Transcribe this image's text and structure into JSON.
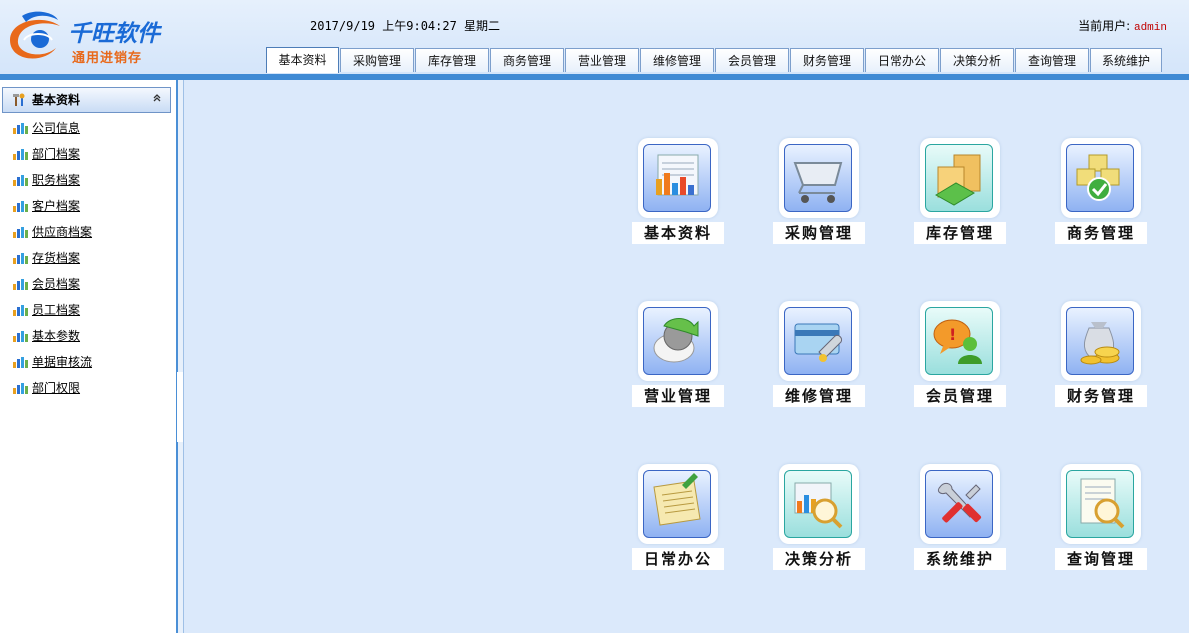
{
  "header": {
    "logo": {
      "brand": "千旺软件",
      "subtitle": "通用进销存"
    },
    "datetime": "2017/9/19 上午9:04:27 星期二",
    "user_label": "当前用户:",
    "user_name": "admin"
  },
  "tabs": [
    {
      "label": "基本资料",
      "active": true
    },
    {
      "label": "采购管理",
      "active": false
    },
    {
      "label": "库存管理",
      "active": false
    },
    {
      "label": "商务管理",
      "active": false
    },
    {
      "label": "营业管理",
      "active": false
    },
    {
      "label": "维修管理",
      "active": false
    },
    {
      "label": "会员管理",
      "active": false
    },
    {
      "label": "财务管理",
      "active": false
    },
    {
      "label": "日常办公",
      "active": false
    },
    {
      "label": "决策分析",
      "active": false
    },
    {
      "label": "查询管理",
      "active": false
    },
    {
      "label": "系统维护",
      "active": false
    }
  ],
  "sidebar": {
    "title": "基本资料",
    "collapse_symbol": "≈",
    "items": [
      {
        "label": "公司信息"
      },
      {
        "label": "部门档案"
      },
      {
        "label": "职务档案"
      },
      {
        "label": "客户档案"
      },
      {
        "label": "供应商档案"
      },
      {
        "label": "存货档案"
      },
      {
        "label": "会员档案"
      },
      {
        "label": "员工档案"
      },
      {
        "label": "基本参数"
      },
      {
        "label": "单据审核流"
      },
      {
        "label": "部门权限"
      }
    ]
  },
  "modules": [
    {
      "label": "基本资料",
      "icon": "chart-folder-icon"
    },
    {
      "label": "采购管理",
      "icon": "shopping-cart-icon"
    },
    {
      "label": "库存管理",
      "icon": "warehouse-boxes-icon"
    },
    {
      "label": "商务管理",
      "icon": "cubes-check-icon"
    },
    {
      "label": "营业管理",
      "icon": "recycle-globe-icon"
    },
    {
      "label": "维修管理",
      "icon": "card-wrench-icon"
    },
    {
      "label": "会员管理",
      "icon": "member-chat-icon"
    },
    {
      "label": "财务管理",
      "icon": "money-bag-icon"
    },
    {
      "label": "日常办公",
      "icon": "notebook-icon"
    },
    {
      "label": "决策分析",
      "icon": "analysis-magnifier-icon"
    },
    {
      "label": "系统维护",
      "icon": "tools-icon"
    },
    {
      "label": "查询管理",
      "icon": "document-search-icon"
    }
  ],
  "colors": {
    "background": "#dbe9fb",
    "topbar": "#3f8ad4",
    "brand_blue": "#1a6ad6",
    "brand_orange": "#e8691b",
    "user_red": "#c00000"
  }
}
